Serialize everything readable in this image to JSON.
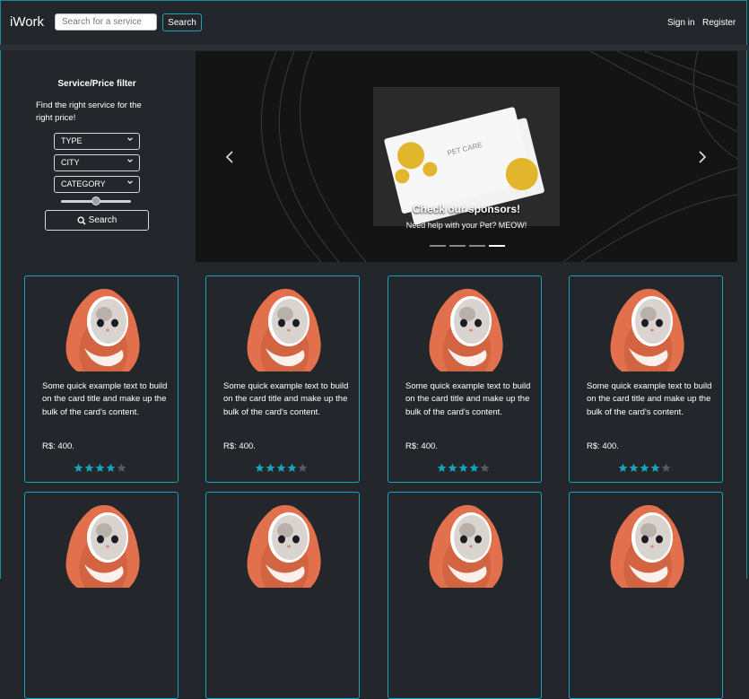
{
  "navbar": {
    "brand": "iWork",
    "search_placeholder": "Search for a service",
    "search_button": "Search",
    "signin": "Sign in",
    "register": "Register"
  },
  "filter": {
    "title": "Service/Price filter",
    "description": "Find the right service for the right price!",
    "selects": [
      "TYPE",
      "CITY",
      "CATEGORY"
    ],
    "price_slider_fraction": 0.5,
    "button_label": "Search"
  },
  "carousel": {
    "caption_title": "Check our sponsors!",
    "caption_text": "Need help with your Pet? MEOW!",
    "card_brand": "PET CARE",
    "slide_count": 4,
    "active_slide": 4
  },
  "cards": [
    {
      "text": "Some quick example text to build on the card title and make up the bulk of the card's content.",
      "price": "R$: 400.",
      "rating": 4,
      "max_rating": 5
    },
    {
      "text": "Some quick example text to build on the card title and make up the bulk of the card's content.",
      "price": "R$: 400.",
      "rating": 4,
      "max_rating": 5
    },
    {
      "text": "Some quick example text to build on the card title and make up the bulk of the card's content.",
      "price": "R$: 400.",
      "rating": 4,
      "max_rating": 5
    },
    {
      "text": "Some quick example text to build on the card title and make up the bulk of the card's content.",
      "price": "R$: 400.",
      "rating": 4,
      "max_rating": 5
    },
    {
      "text": "",
      "price": "",
      "rating": 0,
      "max_rating": 0
    },
    {
      "text": "",
      "price": "",
      "rating": 0,
      "max_rating": 0
    },
    {
      "text": "",
      "price": "",
      "rating": 0,
      "max_rating": 0
    },
    {
      "text": "",
      "price": "",
      "rating": 0,
      "max_rating": 0
    }
  ],
  "colors": {
    "background": "#23272b",
    "accent": "#17a2b8",
    "star_filled": "#17a2b8",
    "star_empty": "#555a60",
    "blanket": "#e2704c"
  },
  "icons": {
    "search": "magnifier-icon",
    "prev": "chevron-left-icon",
    "next": "chevron-right-icon",
    "select": "chevron-down-icon",
    "star": "star-icon"
  }
}
